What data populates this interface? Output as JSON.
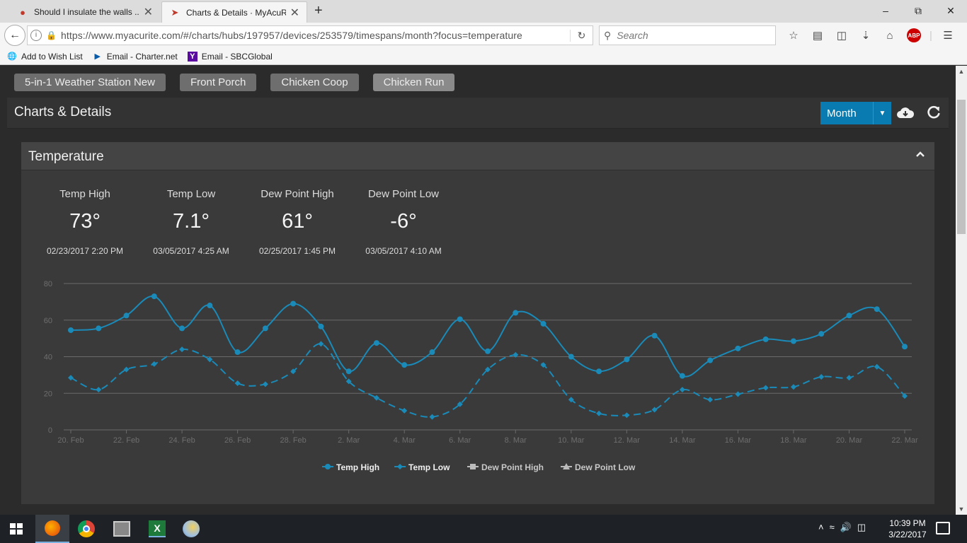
{
  "browser": {
    "tabs": [
      {
        "title": "Should I insulate the walls ...",
        "active": false
      },
      {
        "title": "Charts & Details · MyAcuR...",
        "active": true
      }
    ],
    "url": "https://www.myacurite.com/#/charts/hubs/197957/devices/253579/timespans/month?focus=temperature",
    "search_placeholder": "Search",
    "abp_label": "ABP",
    "bookmarks": [
      "Add to Wish List",
      "Email - Charter.net",
      "Email - SBCGlobal"
    ]
  },
  "device_tabs": [
    "5-in-1 Weather Station New",
    "Front Porch",
    "Chicken Coop",
    "Chicken Run"
  ],
  "selected_device": "Chicken Run",
  "header": {
    "title": "Charts & Details",
    "timespan": "Month"
  },
  "panel": {
    "title": "Temperature",
    "stats": [
      {
        "label": "Temp High",
        "value": "73°",
        "date": "02/23/2017 2:20 PM"
      },
      {
        "label": "Temp Low",
        "value": "7.1°",
        "date": "03/05/2017 4:25 AM"
      },
      {
        "label": "Dew Point High",
        "value": "61°",
        "date": "02/25/2017 1:45 PM"
      },
      {
        "label": "Dew Point Low",
        "value": "-6°",
        "date": "03/05/2017 4:10 AM"
      }
    ]
  },
  "chart_data": {
    "type": "line",
    "x": [
      "20. Feb",
      "21. Feb",
      "22. Feb",
      "23. Feb",
      "24. Feb",
      "25. Feb",
      "26. Feb",
      "27. Feb",
      "28. Feb",
      "1. Mar",
      "2. Mar",
      "3. Mar",
      "4. Mar",
      "5. Mar",
      "6. Mar",
      "7. Mar",
      "8. Mar",
      "9. Mar",
      "10. Mar",
      "11. Mar",
      "12. Mar",
      "13. Mar",
      "14. Mar",
      "15. Mar",
      "16. Mar",
      "17. Mar",
      "18. Mar",
      "19. Mar",
      "20. Mar",
      "21. Mar",
      "22. Mar"
    ],
    "x_tick_labels": [
      "20. Feb",
      "22. Feb",
      "24. Feb",
      "26. Feb",
      "28. Feb",
      "2. Mar",
      "4. Mar",
      "6. Mar",
      "8. Mar",
      "10. Mar",
      "12. Mar",
      "14. Mar",
      "16. Mar",
      "18. Mar",
      "20. Mar",
      "22. Mar"
    ],
    "y_ticks": [
      0,
      20,
      40,
      60,
      80
    ],
    "ylim": [
      0,
      80
    ],
    "series": [
      {
        "name": "Temp High",
        "color": "#1a8ab8",
        "dashed": false,
        "marker": "circle",
        "values": [
          54.5,
          55.5,
          62.5,
          73,
          55.5,
          68,
          42.5,
          55.5,
          69,
          56.5,
          32,
          47.5,
          35.5,
          42.5,
          60.5,
          43,
          64,
          58,
          40,
          32,
          38.5,
          51.5,
          29.5,
          38,
          44.5,
          49.5,
          48.5,
          52.5,
          62.5,
          66,
          45.5
        ]
      },
      {
        "name": "Temp Low",
        "color": "#1a8ab8",
        "dashed": true,
        "marker": "diamond",
        "values": [
          28.5,
          22,
          33,
          36,
          44,
          38.5,
          25.5,
          25,
          32,
          47,
          26.5,
          17.5,
          10.5,
          7.1,
          14,
          33,
          41,
          35.5,
          16.5,
          9,
          8,
          11,
          22,
          16.5,
          19.5,
          23,
          23.5,
          29,
          28.5,
          34.5,
          18.5
        ]
      }
    ],
    "legend": [
      {
        "name": "Temp High",
        "marker": "circle"
      },
      {
        "name": "Temp Low",
        "marker": "diamond"
      },
      {
        "name": "Dew Point High",
        "marker": "square"
      },
      {
        "name": "Dew Point Low",
        "marker": "triangle"
      }
    ],
    "legend_placement": "bottom-center",
    "grid": true
  },
  "taskbar": {
    "time": "10:39 PM",
    "date": "3/22/2017"
  }
}
